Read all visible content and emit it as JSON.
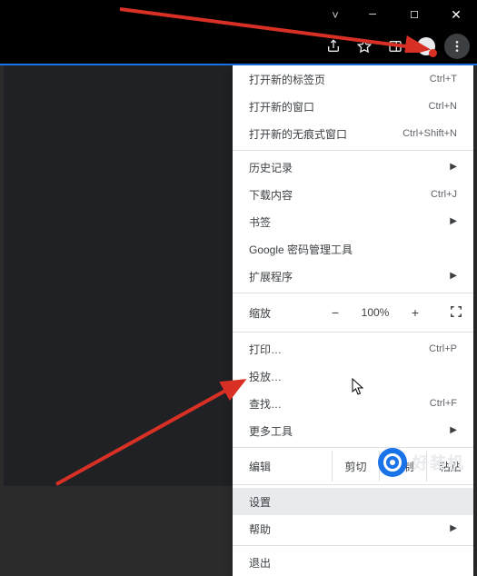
{
  "window": {
    "minimize": "─",
    "maximize": "☐",
    "close": "✕"
  },
  "toolbar": {
    "share_icon": "share-icon",
    "star_icon": "star-icon",
    "sidepanel_icon": "sidepanel-icon",
    "avatar_icon": "avatar-icon",
    "menu_icon": "more-vert-icon"
  },
  "menu": {
    "new_tab": {
      "label": "打开新的标签页",
      "shortcut": "Ctrl+T"
    },
    "new_window": {
      "label": "打开新的窗口",
      "shortcut": "Ctrl+N"
    },
    "incognito": {
      "label": "打开新的无痕式窗口",
      "shortcut": "Ctrl+Shift+N"
    },
    "history": {
      "label": "历史记录"
    },
    "downloads": {
      "label": "下载内容",
      "shortcut": "Ctrl+J"
    },
    "bookmarks": {
      "label": "书签"
    },
    "passwords": {
      "label": "Google 密码管理工具"
    },
    "extensions": {
      "label": "扩展程序"
    },
    "zoom": {
      "label": "缩放",
      "minus": "−",
      "value": "100%",
      "plus": "+"
    },
    "print": {
      "label": "打印…",
      "shortcut": "Ctrl+P"
    },
    "cast": {
      "label": "投放…"
    },
    "find": {
      "label": "查找…",
      "shortcut": "Ctrl+F"
    },
    "more_tools": {
      "label": "更多工具"
    },
    "edit": {
      "label": "编辑",
      "cut": "剪切",
      "copy": "复制",
      "paste": "粘贴"
    },
    "settings": {
      "label": "设置"
    },
    "help": {
      "label": "帮助"
    },
    "exit": {
      "label": "退出"
    }
  },
  "watermark": {
    "text": "好装机"
  },
  "colors": {
    "arrow": "#d93025",
    "accent": "#1a73e8"
  }
}
